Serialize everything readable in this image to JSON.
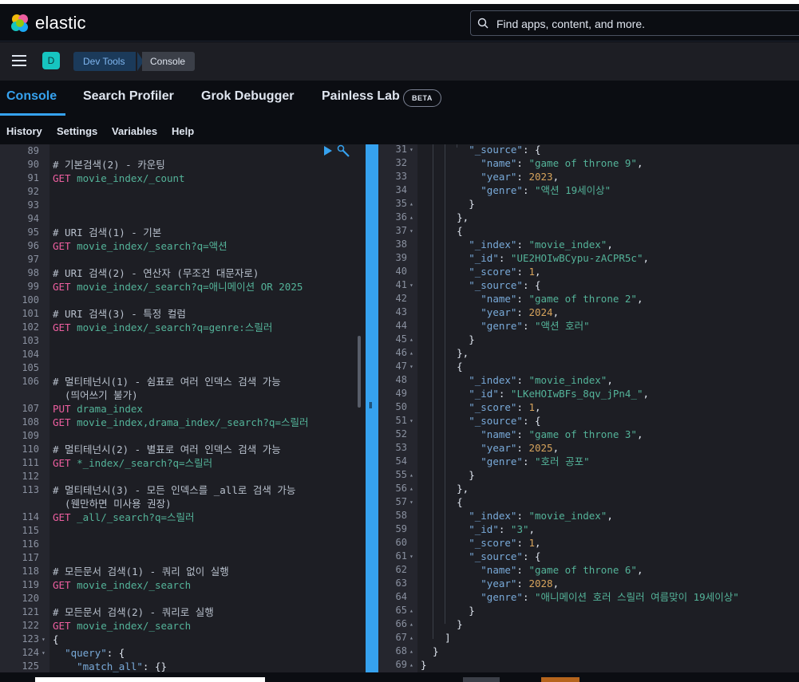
{
  "header": {
    "brand": "elastic",
    "search_placeholder": "Find apps, content, and more."
  },
  "subheader": {
    "space_initial": "D",
    "breadcrumbs": [
      "Dev Tools",
      "Console"
    ]
  },
  "tabs": [
    {
      "label": "Console",
      "active": true
    },
    {
      "label": "Search Profiler",
      "active": false
    },
    {
      "label": "Grok Debugger",
      "active": false
    },
    {
      "label": "Painless Lab",
      "active": false
    }
  ],
  "beta_badge": "BETA",
  "menu": [
    "History",
    "Settings",
    "Variables",
    "Help"
  ],
  "editor": {
    "lines": [
      {
        "n": "89",
        "parts": []
      },
      {
        "n": "90",
        "parts": [
          [
            "c-comment",
            "# 기본검색(2) - 카운팅"
          ]
        ]
      },
      {
        "n": "91",
        "parts": [
          [
            "c-method",
            "GET "
          ],
          [
            "c-url",
            "movie_index/_count"
          ]
        ]
      },
      {
        "n": "92",
        "parts": []
      },
      {
        "n": "93",
        "parts": []
      },
      {
        "n": "94",
        "parts": []
      },
      {
        "n": "95",
        "parts": [
          [
            "c-comment",
            "# URI 검색(1) - 기본"
          ]
        ]
      },
      {
        "n": "96",
        "parts": [
          [
            "c-method",
            "GET "
          ],
          [
            "c-url",
            "movie_index/_search?q=액션"
          ]
        ]
      },
      {
        "n": "97",
        "parts": []
      },
      {
        "n": "98",
        "parts": [
          [
            "c-comment",
            "# URI 검색(2) - 연산자 (무조건 대문자로)"
          ]
        ]
      },
      {
        "n": "99",
        "parts": [
          [
            "c-method",
            "GET "
          ],
          [
            "c-url",
            "movie_index/_search?q=애니메이션 OR 2025"
          ]
        ]
      },
      {
        "n": "100",
        "parts": []
      },
      {
        "n": "101",
        "parts": [
          [
            "c-comment",
            "# URI 검색(3) - 특정 컬럼"
          ]
        ]
      },
      {
        "n": "102",
        "parts": [
          [
            "c-method",
            "GET "
          ],
          [
            "c-url",
            "movie_index/_search?q=genre:스릴러"
          ]
        ]
      },
      {
        "n": "103",
        "parts": []
      },
      {
        "n": "104",
        "parts": []
      },
      {
        "n": "105",
        "parts": []
      },
      {
        "n": "106",
        "parts": [
          [
            "c-comment",
            "# 멀티테넌시(1) - 쉼표로 여러 인덱스 검색 가능"
          ]
        ]
      },
      {
        "n": "",
        "parts": [
          [
            "c-comment",
            "  (띄어쓰기 불가)"
          ]
        ]
      },
      {
        "n": "107",
        "parts": [
          [
            "c-method",
            "PUT "
          ],
          [
            "c-url",
            "drama_index"
          ]
        ]
      },
      {
        "n": "108",
        "parts": [
          [
            "c-method",
            "GET "
          ],
          [
            "c-url",
            "movie_index,drama_index/_search?q=스릴러"
          ]
        ]
      },
      {
        "n": "109",
        "parts": []
      },
      {
        "n": "110",
        "parts": [
          [
            "c-comment",
            "# 멀티테넌시(2) - 별표로 여러 인덱스 검색 가능"
          ]
        ]
      },
      {
        "n": "111",
        "parts": [
          [
            "c-method",
            "GET "
          ],
          [
            "c-url",
            "*_index/_search?q=스릴러"
          ]
        ]
      },
      {
        "n": "112",
        "parts": []
      },
      {
        "n": "113",
        "parts": [
          [
            "c-comment",
            "# 멀티테넌시(3) - 모든 인덱스를 _all로 검색 가능"
          ]
        ]
      },
      {
        "n": "",
        "parts": [
          [
            "c-comment",
            "  (웬만하면 미사용 권장)"
          ]
        ]
      },
      {
        "n": "114",
        "parts": [
          [
            "c-method",
            "GET "
          ],
          [
            "c-url",
            "_all/_search?q=스릴러"
          ]
        ]
      },
      {
        "n": "115",
        "parts": []
      },
      {
        "n": "116",
        "parts": []
      },
      {
        "n": "117",
        "parts": []
      },
      {
        "n": "118",
        "parts": [
          [
            "c-comment",
            "# 모든문서 검색(1) - 쿼리 없이 실행"
          ]
        ]
      },
      {
        "n": "119",
        "parts": [
          [
            "c-method",
            "GET "
          ],
          [
            "c-url",
            "movie_index/_search"
          ]
        ]
      },
      {
        "n": "120",
        "parts": []
      },
      {
        "n": "121",
        "parts": [
          [
            "c-comment",
            "# 모든문서 검색(2) - 쿼리로 실행"
          ]
        ]
      },
      {
        "n": "122",
        "parts": [
          [
            "c-method",
            "GET "
          ],
          [
            "c-url",
            "movie_index/_search"
          ]
        ]
      },
      {
        "n": "123",
        "fold": "▾",
        "parts": [
          [
            "c-punct",
            "{"
          ]
        ]
      },
      {
        "n": "124",
        "fold": "▾",
        "parts": [
          [
            "c-punct",
            "  "
          ],
          [
            "c-key",
            "\"query\""
          ],
          [
            "c-punct",
            ": {"
          ]
        ]
      },
      {
        "n": "125",
        "parts": [
          [
            "c-punct",
            "    "
          ],
          [
            "c-key",
            "\"match_all\""
          ],
          [
            "c-punct",
            ": {}"
          ]
        ]
      }
    ]
  },
  "output": {
    "lines": [
      {
        "n": "31",
        "fold": "▾",
        "parts": [
          [
            "c-punct",
            "        "
          ],
          [
            "c-key",
            "\"_source\""
          ],
          [
            "c-punct",
            ": {"
          ]
        ]
      },
      {
        "n": "32",
        "parts": [
          [
            "c-punct",
            "          "
          ],
          [
            "c-key",
            "\"name\""
          ],
          [
            "c-punct",
            ": "
          ],
          [
            "c-str",
            "\"game of throne 9\""
          ],
          [
            "c-punct",
            ","
          ]
        ]
      },
      {
        "n": "33",
        "parts": [
          [
            "c-punct",
            "          "
          ],
          [
            "c-key",
            "\"year\""
          ],
          [
            "c-punct",
            ": "
          ],
          [
            "c-num",
            "2023"
          ],
          [
            "c-punct",
            ","
          ]
        ]
      },
      {
        "n": "34",
        "parts": [
          [
            "c-punct",
            "          "
          ],
          [
            "c-key",
            "\"genre\""
          ],
          [
            "c-punct",
            ": "
          ],
          [
            "c-str",
            "\"액션 19세이상\""
          ]
        ]
      },
      {
        "n": "35",
        "fold": "▴",
        "parts": [
          [
            "c-punct",
            "        }"
          ]
        ]
      },
      {
        "n": "36",
        "fold": "▴",
        "parts": [
          [
            "c-punct",
            "      },"
          ]
        ]
      },
      {
        "n": "37",
        "fold": "▾",
        "parts": [
          [
            "c-punct",
            "      {"
          ]
        ]
      },
      {
        "n": "38",
        "parts": [
          [
            "c-punct",
            "        "
          ],
          [
            "c-key",
            "\"_index\""
          ],
          [
            "c-punct",
            ": "
          ],
          [
            "c-str",
            "\"movie_index\""
          ],
          [
            "c-punct",
            ","
          ]
        ]
      },
      {
        "n": "39",
        "parts": [
          [
            "c-punct",
            "        "
          ],
          [
            "c-key",
            "\"_id\""
          ],
          [
            "c-punct",
            ": "
          ],
          [
            "c-str",
            "\"UE2HOIwBCypu-zACPR5c\""
          ],
          [
            "c-punct",
            ","
          ]
        ]
      },
      {
        "n": "40",
        "parts": [
          [
            "c-punct",
            "        "
          ],
          [
            "c-key",
            "\"_score\""
          ],
          [
            "c-punct",
            ": "
          ],
          [
            "c-num",
            "1"
          ],
          [
            "c-punct",
            ","
          ]
        ]
      },
      {
        "n": "41",
        "fold": "▾",
        "parts": [
          [
            "c-punct",
            "        "
          ],
          [
            "c-key",
            "\"_source\""
          ],
          [
            "c-punct",
            ": {"
          ]
        ]
      },
      {
        "n": "42",
        "parts": [
          [
            "c-punct",
            "          "
          ],
          [
            "c-key",
            "\"name\""
          ],
          [
            "c-punct",
            ": "
          ],
          [
            "c-str",
            "\"game of throne 2\""
          ],
          [
            "c-punct",
            ","
          ]
        ]
      },
      {
        "n": "43",
        "parts": [
          [
            "c-punct",
            "          "
          ],
          [
            "c-key",
            "\"year\""
          ],
          [
            "c-punct",
            ": "
          ],
          [
            "c-num",
            "2024"
          ],
          [
            "c-punct",
            ","
          ]
        ]
      },
      {
        "n": "44",
        "parts": [
          [
            "c-punct",
            "          "
          ],
          [
            "c-key",
            "\"genre\""
          ],
          [
            "c-punct",
            ": "
          ],
          [
            "c-str",
            "\"액션 호러\""
          ]
        ]
      },
      {
        "n": "45",
        "fold": "▴",
        "parts": [
          [
            "c-punct",
            "        }"
          ]
        ]
      },
      {
        "n": "46",
        "fold": "▴",
        "parts": [
          [
            "c-punct",
            "      },"
          ]
        ]
      },
      {
        "n": "47",
        "fold": "▾",
        "parts": [
          [
            "c-punct",
            "      {"
          ]
        ]
      },
      {
        "n": "48",
        "parts": [
          [
            "c-punct",
            "        "
          ],
          [
            "c-key",
            "\"_index\""
          ],
          [
            "c-punct",
            ": "
          ],
          [
            "c-str",
            "\"movie_index\""
          ],
          [
            "c-punct",
            ","
          ]
        ]
      },
      {
        "n": "49",
        "parts": [
          [
            "c-punct",
            "        "
          ],
          [
            "c-key",
            "\"_id\""
          ],
          [
            "c-punct",
            ": "
          ],
          [
            "c-str",
            "\"LKeHOIwBFs_8qv_jPn4_\""
          ],
          [
            "c-punct",
            ","
          ]
        ]
      },
      {
        "n": "50",
        "parts": [
          [
            "c-punct",
            "        "
          ],
          [
            "c-key",
            "\"_score\""
          ],
          [
            "c-punct",
            ": "
          ],
          [
            "c-num",
            "1"
          ],
          [
            "c-punct",
            ","
          ]
        ]
      },
      {
        "n": "51",
        "fold": "▾",
        "parts": [
          [
            "c-punct",
            "        "
          ],
          [
            "c-key",
            "\"_source\""
          ],
          [
            "c-punct",
            ": {"
          ]
        ]
      },
      {
        "n": "52",
        "parts": [
          [
            "c-punct",
            "          "
          ],
          [
            "c-key",
            "\"name\""
          ],
          [
            "c-punct",
            ": "
          ],
          [
            "c-str",
            "\"game of throne 3\""
          ],
          [
            "c-punct",
            ","
          ]
        ]
      },
      {
        "n": "53",
        "parts": [
          [
            "c-punct",
            "          "
          ],
          [
            "c-key",
            "\"year\""
          ],
          [
            "c-punct",
            ": "
          ],
          [
            "c-num",
            "2025"
          ],
          [
            "c-punct",
            ","
          ]
        ]
      },
      {
        "n": "54",
        "parts": [
          [
            "c-punct",
            "          "
          ],
          [
            "c-key",
            "\"genre\""
          ],
          [
            "c-punct",
            ": "
          ],
          [
            "c-str",
            "\"호러 공포\""
          ]
        ]
      },
      {
        "n": "55",
        "fold": "▴",
        "parts": [
          [
            "c-punct",
            "        }"
          ]
        ]
      },
      {
        "n": "56",
        "fold": "▴",
        "parts": [
          [
            "c-punct",
            "      },"
          ]
        ]
      },
      {
        "n": "57",
        "fold": "▾",
        "parts": [
          [
            "c-punct",
            "      {"
          ]
        ]
      },
      {
        "n": "58",
        "parts": [
          [
            "c-punct",
            "        "
          ],
          [
            "c-key",
            "\"_index\""
          ],
          [
            "c-punct",
            ": "
          ],
          [
            "c-str",
            "\"movie_index\""
          ],
          [
            "c-punct",
            ","
          ]
        ]
      },
      {
        "n": "59",
        "parts": [
          [
            "c-punct",
            "        "
          ],
          [
            "c-key",
            "\"_id\""
          ],
          [
            "c-punct",
            ": "
          ],
          [
            "c-str",
            "\"3\""
          ],
          [
            "c-punct",
            ","
          ]
        ]
      },
      {
        "n": "60",
        "parts": [
          [
            "c-punct",
            "        "
          ],
          [
            "c-key",
            "\"_score\""
          ],
          [
            "c-punct",
            ": "
          ],
          [
            "c-num",
            "1"
          ],
          [
            "c-punct",
            ","
          ]
        ]
      },
      {
        "n": "61",
        "fold": "▾",
        "parts": [
          [
            "c-punct",
            "        "
          ],
          [
            "c-key",
            "\"_source\""
          ],
          [
            "c-punct",
            ": {"
          ]
        ]
      },
      {
        "n": "62",
        "parts": [
          [
            "c-punct",
            "          "
          ],
          [
            "c-key",
            "\"name\""
          ],
          [
            "c-punct",
            ": "
          ],
          [
            "c-str",
            "\"game of throne 6\""
          ],
          [
            "c-punct",
            ","
          ]
        ]
      },
      {
        "n": "63",
        "parts": [
          [
            "c-punct",
            "          "
          ],
          [
            "c-key",
            "\"year\""
          ],
          [
            "c-punct",
            ": "
          ],
          [
            "c-num",
            "2028"
          ],
          [
            "c-punct",
            ","
          ]
        ]
      },
      {
        "n": "64",
        "parts": [
          [
            "c-punct",
            "          "
          ],
          [
            "c-key",
            "\"genre\""
          ],
          [
            "c-punct",
            ": "
          ],
          [
            "c-str",
            "\"애니메이션 호러 스릴러 여름맞이 19세이상\""
          ]
        ]
      },
      {
        "n": "65",
        "fold": "▴",
        "parts": [
          [
            "c-punct",
            "        }"
          ]
        ]
      },
      {
        "n": "66",
        "fold": "▴",
        "parts": [
          [
            "c-punct",
            "      }"
          ]
        ]
      },
      {
        "n": "67",
        "fold": "▴",
        "parts": [
          [
            "c-punct",
            "    ]"
          ]
        ]
      },
      {
        "n": "68",
        "fold": "▴",
        "parts": [
          [
            "c-punct",
            "  }"
          ]
        ]
      },
      {
        "n": "69",
        "fold": "▴",
        "parts": [
          [
            "c-punct",
            "}"
          ]
        ]
      }
    ]
  }
}
